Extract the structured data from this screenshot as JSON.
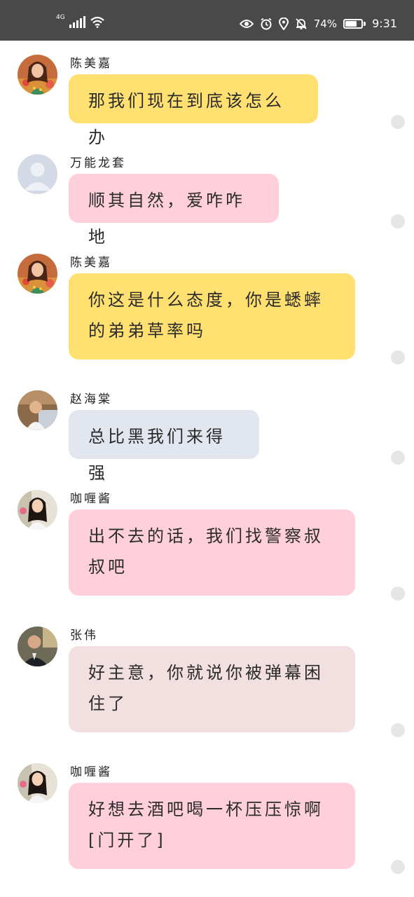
{
  "status_bar": {
    "network": "4G",
    "battery": "74%",
    "battery_level": 0.74,
    "time": "9:31"
  },
  "colors": {
    "yellow": "#ffe070",
    "pink": "#ffd0dc",
    "blue_gray": "#e1e6ef",
    "mauve": "#f2dfe0",
    "status_bar": "#494949"
  },
  "messages": [
    {
      "sender": "陈美嘉",
      "avatar": "avatar-chen-meijia",
      "color": "yellow",
      "lines": [
        "那我们现在到底该怎么办"
      ]
    },
    {
      "sender": "万能龙套",
      "avatar": "default-avatar",
      "color": "pink",
      "lines": [
        "顺其自然，爱咋咋地"
      ]
    },
    {
      "sender": "陈美嘉",
      "avatar": "avatar-chen-meijia",
      "color": "yellow",
      "lines": [
        "你这是什么态度，你是蟋蟀",
        "的弟弟草率吗"
      ]
    },
    {
      "sender": "赵海棠",
      "avatar": "avatar-zhao-haitang",
      "color": "blue_gray",
      "lines": [
        "总比黑我们来得强"
      ]
    },
    {
      "sender": "咖喱酱",
      "avatar": "avatar-gali-jiang",
      "color": "pink",
      "lines": [
        "出不去的话，我们找警察叔",
        "叔吧"
      ]
    },
    {
      "sender": "张伟",
      "avatar": "avatar-zhang-wei",
      "color": "mauve",
      "lines": [
        "好主意，你就说你被弹幕困",
        "住了"
      ]
    },
    {
      "sender": "咖喱酱",
      "avatar": "avatar-gali-jiang",
      "color": "pink",
      "lines": [
        "好想去酒吧喝一杯压压惊啊",
        "[门开了]"
      ]
    }
  ]
}
